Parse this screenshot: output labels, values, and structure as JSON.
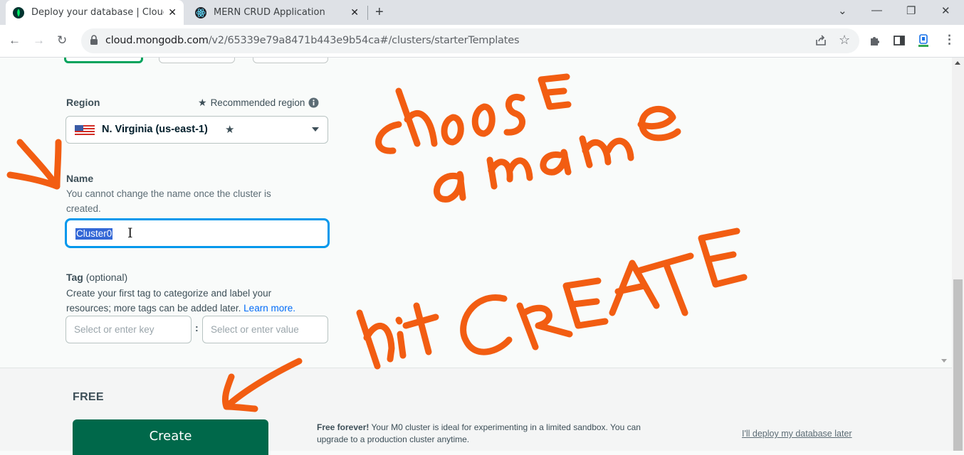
{
  "browser": {
    "tabs": [
      {
        "title": "Deploy your database | Cloud: M"
      },
      {
        "title": "MERN CRUD Application"
      }
    ],
    "address": {
      "domain": "cloud.mongodb.com",
      "path": "/v2/65339e79a8471b443e9b54ca#/clusters/starterTemplates"
    }
  },
  "region": {
    "label": "Region",
    "recommended_label": "Recommended region",
    "selected_value": "N. Virginia (us-east-1)"
  },
  "name": {
    "label": "Name",
    "help": "You cannot change the name once the cluster is created.",
    "value": "Cluster0"
  },
  "tag": {
    "label": "Tag",
    "optional": "(optional)",
    "help": "Create your first tag to categorize and label your resources; more tags can be added later.",
    "learn_more": "Learn more.",
    "key_placeholder": "Select or enter key",
    "value_placeholder": "Select or enter value"
  },
  "footer": {
    "tier": "FREE",
    "create_label": "Create",
    "free_forever_bold": "Free forever!",
    "free_forever_text": "Your M0 cluster is ideal for experimenting in a limited sandbox. You can upgrade to a production cluster anytime.",
    "deploy_later": "I'll deploy my database later"
  },
  "annotations": {
    "choose_a_name": "choose a name",
    "hit_create": "hit CREATE"
  },
  "colors": {
    "brand_green": "#00684a",
    "focus_blue": "#0498ec",
    "annotation_orange": "#f25d12",
    "link_blue": "#016bf8"
  }
}
